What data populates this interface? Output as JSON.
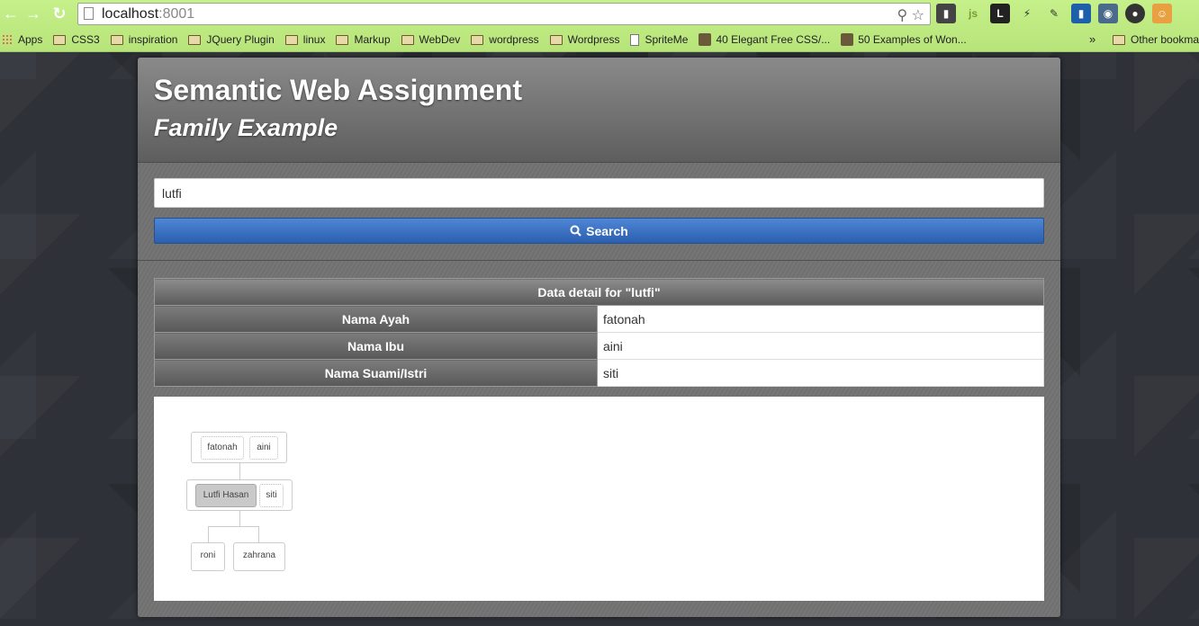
{
  "browser": {
    "url_host": "localhost",
    "url_port": ":8001",
    "bookmarks": [
      {
        "label": "Apps",
        "type": "apps"
      },
      {
        "label": "CSS3",
        "type": "folder"
      },
      {
        "label": "inspiration",
        "type": "folder"
      },
      {
        "label": "JQuery Plugin",
        "type": "folder"
      },
      {
        "label": "linux",
        "type": "folder"
      },
      {
        "label": "Markup",
        "type": "folder"
      },
      {
        "label": "WebDev",
        "type": "folder"
      },
      {
        "label": "wordpress",
        "type": "folder"
      },
      {
        "label": "Wordpress",
        "type": "folder"
      },
      {
        "label": "SpriteMe",
        "type": "doc"
      },
      {
        "label": "40 Elegant Free CSS/...",
        "type": "site"
      },
      {
        "label": "50 Examples of Won...",
        "type": "site"
      }
    ],
    "more": "»",
    "other_bookmarks": "Other bookma"
  },
  "header": {
    "title": "Semantic Web Assignment",
    "subtitle": "Family Example"
  },
  "search": {
    "value": "lutfi",
    "button_label": "Search"
  },
  "detail": {
    "caption": "Data detail for \"lutfi\"",
    "rows": [
      {
        "key": "Nama Ayah",
        "value": "fatonah"
      },
      {
        "key": "Nama Ibu",
        "value": "aini"
      },
      {
        "key": "Nama Suami/Istri",
        "value": "siti"
      }
    ]
  },
  "tree": {
    "parents": [
      "fatonah",
      "aini"
    ],
    "self": "Lutfi Hasan",
    "spouse": "siti",
    "children": [
      "roni",
      "zahrana"
    ]
  }
}
